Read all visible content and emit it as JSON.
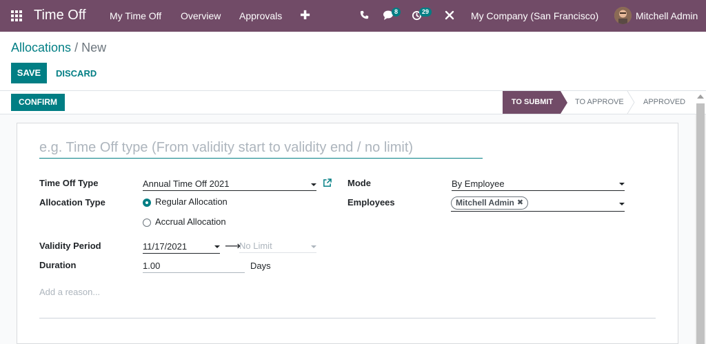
{
  "navbar": {
    "app_name": "Time Off",
    "menus": [
      "My Time Off",
      "Overview",
      "Approvals"
    ],
    "chat_badge": "8",
    "activity_badge": "29",
    "company": "My Company (San Francisco)",
    "user": "Mitchell Admin",
    "bg_color": "#714B67"
  },
  "breadcrumb": {
    "parent": "Allocations",
    "separator": "/",
    "current": "New"
  },
  "buttons": {
    "save": "SAVE",
    "discard": "DISCARD",
    "confirm": "CONFIRM"
  },
  "statusbar": {
    "stages": [
      "TO SUBMIT",
      "TO APPROVE",
      "APPROVED"
    ],
    "active": "TO SUBMIT"
  },
  "form": {
    "name_placeholder": "e.g. Time Off type (From validity start to validity end / no limit)",
    "time_off_type_label": "Time Off Type",
    "time_off_type_value": "Annual Time Off 2021",
    "allocation_type_label": "Allocation Type",
    "allocation_options": [
      "Regular Allocation",
      "Accrual Allocation"
    ],
    "allocation_selected": "Regular Allocation",
    "validity_label": "Validity Period",
    "validity_start": "11/17/2021",
    "validity_end_placeholder": "No Limit",
    "duration_label": "Duration",
    "duration_value": "1.00",
    "duration_unit": "Days",
    "mode_label": "Mode",
    "mode_value": "By Employee",
    "employees_label": "Employees",
    "employees": [
      "Mitchell Admin"
    ],
    "reason_placeholder": "Add a reason..."
  },
  "colors": {
    "primary": "#017E84",
    "brand": "#714B67"
  }
}
